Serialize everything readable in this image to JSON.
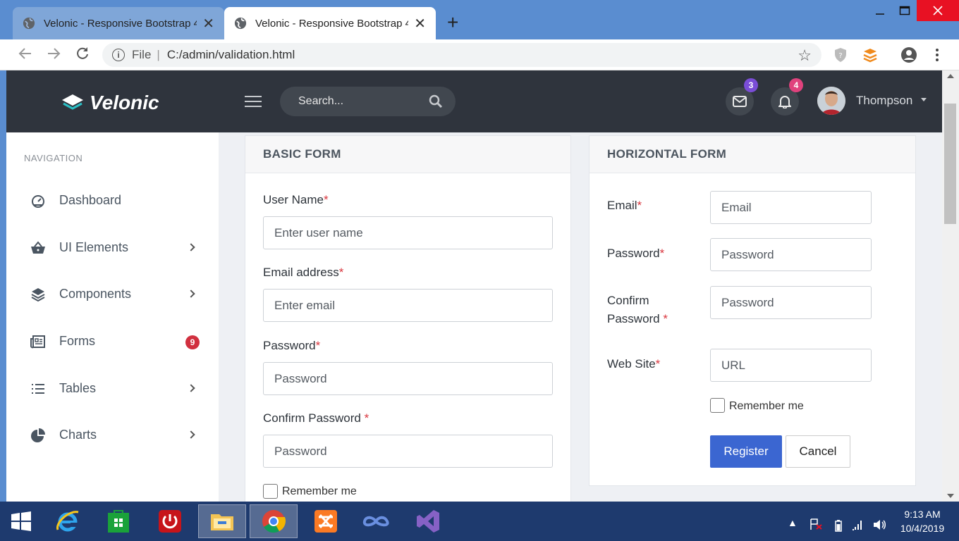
{
  "browser": {
    "tabs": [
      {
        "title": "Velonic - Responsive Bootstrap 4"
      },
      {
        "title": "Velonic - Responsive Bootstrap 4"
      }
    ],
    "new_tab_label": "+",
    "address": {
      "scheme": "File",
      "url": "C:/admin/validation.html"
    }
  },
  "header": {
    "logo_text": "Velonic",
    "search_placeholder": "Search...",
    "mail_count": "3",
    "notification_count": "4",
    "username": "Thompson"
  },
  "sidebar": {
    "heading": "NAVIGATION",
    "items": [
      {
        "label": "Dashboard",
        "icon": "dashboard-icon"
      },
      {
        "label": "UI Elements",
        "icon": "basket-icon"
      },
      {
        "label": "Components",
        "icon": "layers-icon"
      },
      {
        "label": "Forms",
        "icon": "newspaper-icon",
        "badge": "9"
      },
      {
        "label": "Tables",
        "icon": "list-icon"
      },
      {
        "label": "Charts",
        "icon": "pie-chart-icon"
      }
    ]
  },
  "basic_form": {
    "title": "BASIC FORM",
    "username_label": "User Name",
    "username_placeholder": "Enter user name",
    "email_label": "Email address",
    "email_placeholder": "Enter email",
    "password_label": "Password",
    "password_placeholder": "Password",
    "confirm_label": "Confirm Password",
    "confirm_placeholder": "Password",
    "remember_label": "Remember me",
    "required_mark": "*"
  },
  "horizontal_form": {
    "title": "HORIZONTAL FORM",
    "email_label": "Email",
    "email_placeholder": "Email",
    "password_label": "Password",
    "password_placeholder": "Password",
    "confirm_label_line1": "Confirm",
    "confirm_label_line2": "Password",
    "confirm_placeholder": "Password",
    "website_label": "Web Site",
    "website_placeholder": "URL",
    "remember_label": "Remember me",
    "register_label": "Register",
    "cancel_label": "Cancel",
    "required_mark": "*"
  },
  "taskbar": {
    "time": "9:13 AM",
    "date": "10/4/2019"
  },
  "colors": {
    "header_bg": "#2f343d",
    "primary_button": "#3b66d1",
    "required": "#d9363e",
    "badge_purple": "#7a4dd6",
    "badge_pink": "#e0427d",
    "badge_red": "#d1303f"
  }
}
